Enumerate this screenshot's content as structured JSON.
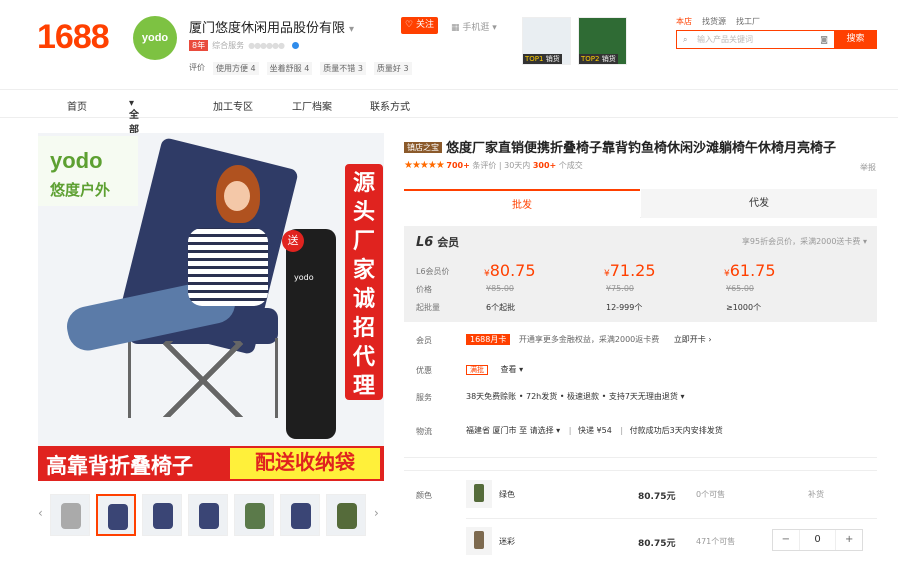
{
  "header": {
    "logo": "1688",
    "shop_logo_text": "yodo",
    "shop_name": "厦门悠度休闲用品股份有限",
    "follow": "关注",
    "mobile": "手机逛",
    "years_badge": "8年",
    "overall_label": "综合服务",
    "ratings_label": "评价",
    "ratings": [
      {
        "name": "使用方便",
        "score": "4"
      },
      {
        "name": "坐着舒服",
        "score": "4"
      },
      {
        "name": "质量不错",
        "score": "3"
      },
      {
        "name": "质量好",
        "score": "3"
      }
    ],
    "top_items": [
      {
        "rank": "TOP1",
        "label": "销货"
      },
      {
        "rank": "TOP2",
        "label": "销货"
      }
    ],
    "search_scopes": [
      "本店",
      "找货源",
      "找工厂"
    ],
    "search_placeholder": "输入产品关键词",
    "search_button": "搜索"
  },
  "nav": [
    "首页",
    "全部商品",
    "加工专区",
    "工厂档案",
    "联系方式"
  ],
  "main_image": {
    "brand_en": "yodo",
    "brand_cn": "悠度户外",
    "gift": "送",
    "banner_vertical": "源头厂家 诚招代理",
    "bottom_left": "高靠背折叠椅子",
    "bottom_right": "配送收纳袋",
    "bag_label": "yodo"
  },
  "product": {
    "shop_tag": "镇店之宝",
    "title": "悠度厂家直销便携折叠椅子靠背钓鱼椅休闲沙滩躺椅午休椅月亮椅子",
    "reviews_count": "700+",
    "reviews_label": "条评价",
    "sales_prefix": "30天内",
    "sales_count": "300+",
    "sales_suffix": "个成交",
    "report": "举报"
  },
  "tabs": [
    "批发",
    "代发"
  ],
  "membership": {
    "level_prefix": "L6",
    "level_label": "会员",
    "discount_note": "享95折会员价，采满2000送卡费",
    "price_label": "L6会员价",
    "orig_label": "价格",
    "moq_label": "起批量",
    "tiers": [
      {
        "price": "80.75",
        "original": "¥85.00",
        "batch": "6个起批"
      },
      {
        "price": "71.25",
        "original": "¥75.00",
        "batch": "12-999个"
      },
      {
        "price": "61.75",
        "original": "¥65.00",
        "batch": "≥1000个"
      }
    ],
    "currency": "¥"
  },
  "info": {
    "member_label": "会员",
    "member_card": "1688月卡",
    "member_text": "开通享更多金融权益，采满2000返卡费",
    "member_action": "立即开卡",
    "promo_label": "优惠",
    "promo_tag": "满批",
    "promo_action": "查看",
    "service_label": "服务",
    "service_text": "38天免费赊账 • 72h发货 • 极速退款 • 支持7天无理由退货",
    "logistics_label": "物流",
    "logistics_text": "福建省 厦门市  至  请选择",
    "shipping": "快递  ¥54",
    "ship_note": "付款成功后3天内安排发货"
  },
  "colors": {
    "label": "颜色",
    "items": [
      {
        "name": "绿色",
        "price": "80.75元",
        "stock": "0个可售",
        "note": "补货",
        "swatch": "#556b3a"
      },
      {
        "name": "迷彩",
        "price": "80.75元",
        "stock": "471个可售",
        "note": "",
        "swatch": "#7d6a4f"
      }
    ],
    "qty": "0"
  },
  "theme": {
    "accent": "#ff4000",
    "brand_green": "#7dc242"
  }
}
